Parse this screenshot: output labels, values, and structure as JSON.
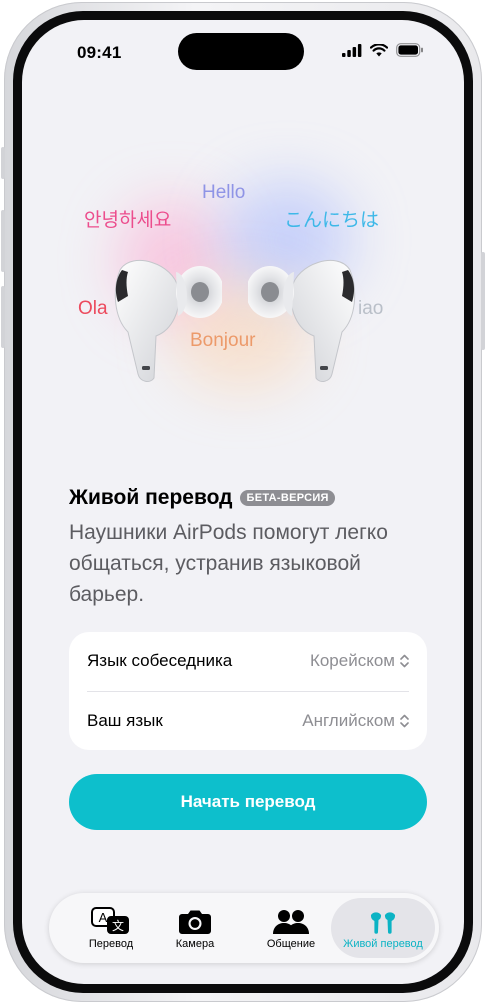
{
  "status": {
    "time": "09:41"
  },
  "hero": {
    "words": [
      "Hello",
      "안녕하세요",
      "こんにちは",
      "Ola",
      "Bonjour",
      "iao"
    ]
  },
  "feature": {
    "title": "Живой перевод",
    "badge": "БЕТА-ВЕРСИЯ",
    "description": "Наушники AirPods помогут легко общаться, устранив языковой барьер."
  },
  "settings": {
    "rows": [
      {
        "label": "Язык собеседника",
        "value": "Корейском"
      },
      {
        "label": "Ваш язык",
        "value": "Английском"
      }
    ]
  },
  "start_button": {
    "label": "Начать перевод"
  },
  "tabbar": {
    "tabs": [
      {
        "label": "Перевод",
        "icon": "translate-icon",
        "active": false
      },
      {
        "label": "Камера",
        "icon": "camera-icon",
        "active": false
      },
      {
        "label": "Общение",
        "icon": "people-icon",
        "active": false
      },
      {
        "label": "Живой перевод",
        "icon": "airpods-icon",
        "active": true
      }
    ]
  },
  "colors": {
    "accent": "#0dbfcc",
    "active_tab_label": "#0cb3c4",
    "background": "#f2f2f6",
    "word_hello": "#8f94e6",
    "word_korean": "#ec4d8d",
    "word_japanese": "#3db8e8",
    "word_ola": "#ec4a5d",
    "word_bonjour": "#ec9a6a",
    "word_ciao": "#b9bfc8"
  }
}
